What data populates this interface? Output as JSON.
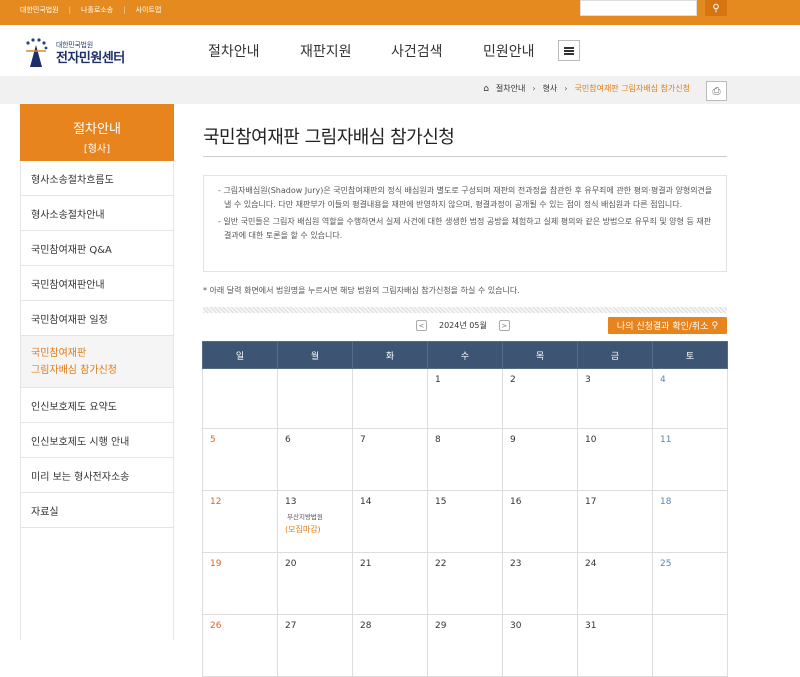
{
  "top_links": [
    "대한민국법원",
    "나홀로소송",
    "사이트맵"
  ],
  "search": {
    "button_icon": "search-icon"
  },
  "logo": {
    "small": "대한민국법원",
    "big": "전자민원센터"
  },
  "gnb": [
    "절차안내",
    "재판지원",
    "사건검색",
    "민원안내"
  ],
  "breadcrumb": {
    "home_icon": "home-icon",
    "items": [
      "절차안내",
      "형사"
    ],
    "current": "국민참여재판 그림자배심 참가신청"
  },
  "sidebar": {
    "title": "절차안내",
    "subtitle": "[형사]",
    "items": [
      {
        "label": "형사소송절차흐름도"
      },
      {
        "label": "형사소송절차안내"
      },
      {
        "label": "국민참여재판 Q&A"
      },
      {
        "label": "국민참여재판안내"
      },
      {
        "label": "국민참여재판 일정"
      },
      {
        "label": "국민참여재판",
        "label2": "그림자배심 참가신청",
        "active": true
      },
      {
        "label": "인신보호제도 요약도"
      },
      {
        "label": "인신보호제도 시행 안내"
      },
      {
        "label": "미리 보는 형사전자소송"
      },
      {
        "label": "자료실"
      }
    ]
  },
  "page_title": "국민참여재판 그림자배심 참가신청",
  "info": [
    "- 그림자배심원(Shadow Jury)은 국민참여재판의 정식 배심원과 별도로 구성되며 재판의 전과정을 참관한 후 유무죄에 관한 평의·평결과 양형의견을 낼 수 있습니다. 다만 재판부가 이들의 평결내용을 재판에 반영하지 않으며, 평결과정이 공개될 수 있는 점이 정식 배심원과 다른 점입니다.",
    "- 일반 국민들은 그림자 배심원 역할을 수행하면서 실제 사건에 대한 생생한 법정 공방을 체험하고 실제 평의와 같은 방법으로 유무죄 및 양형 등 재판 결과에 대한 토론을 할 수 있습니다."
  ],
  "note": "* 아래 달력 화면에서 법원명을 누르시면 해당 법원의 그림자배심 참가신청을 하실 수 있습니다.",
  "calendar": {
    "month_label": "2024년 05월",
    "prev": "<",
    "next": ">",
    "my_button": "나의 신청결과 확인/취소",
    "weekdays": [
      "일",
      "월",
      "화",
      "수",
      "목",
      "금",
      "토"
    ],
    "weeks": [
      [
        "",
        "",
        "",
        "1",
        "2",
        "3",
        "4"
      ],
      [
        "5",
        "6",
        "7",
        "8",
        "9",
        "10",
        "11"
      ],
      [
        "12",
        "13",
        "14",
        "15",
        "16",
        "17",
        "18"
      ],
      [
        "19",
        "20",
        "21",
        "22",
        "23",
        "24",
        "25"
      ],
      [
        "26",
        "27",
        "28",
        "29",
        "30",
        "31",
        ""
      ]
    ],
    "event": {
      "court": "부산지방법원",
      "status": "(모집마감)"
    }
  },
  "colors": {
    "brand": "#e58a1f",
    "header": "#3d5472",
    "sunday": "#e0641e",
    "saturday": "#5a86b3"
  }
}
